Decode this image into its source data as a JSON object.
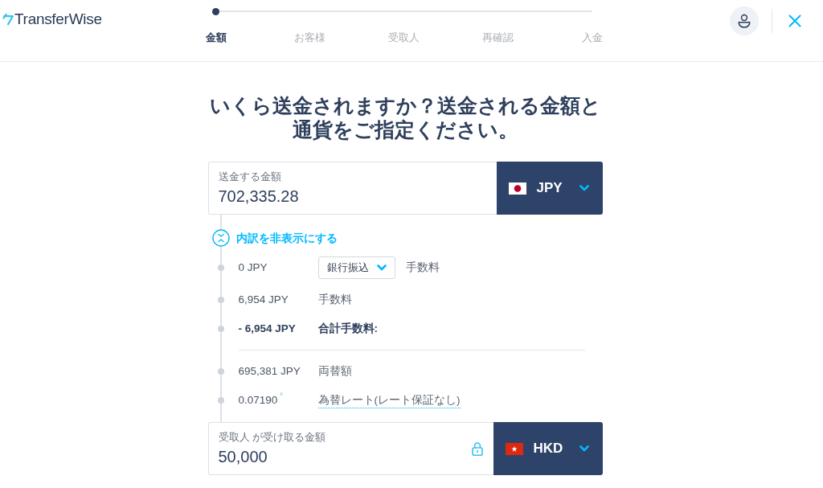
{
  "header": {
    "logo": "TransferWise",
    "steps": [
      {
        "label": "金額",
        "selected": true
      },
      {
        "label": "お客様",
        "selected": false
      },
      {
        "label": "受取人",
        "selected": false
      },
      {
        "label": "再確認",
        "selected": false
      },
      {
        "label": "入金",
        "selected": false
      }
    ]
  },
  "title": "いくら送金されますか？送金される金額と通貨をご指定ください。",
  "send": {
    "kind": "jp",
    "label": "送金する金額",
    "value": "702,335.28",
    "currency": "JPY"
  },
  "breakdown": {
    "toggle": "内訳を非表示にする",
    "expanded": true,
    "rows": [
      {
        "kind": "select",
        "amount": "0 JPY",
        "method": "銀行振込",
        "label": "手数料"
      },
      {
        "kind": "plain",
        "amount": "6,954 JPY",
        "label": "手数料"
      },
      {
        "kind": "total",
        "amount": "- 6,954 JPY",
        "label": "合計手数料:"
      },
      {
        "kind": "plain",
        "amount": "695,381 JPY",
        "label": "両替額"
      },
      {
        "kind": "rate",
        "amount": "0.07190",
        "label": "為替レート(レート保証なし)"
      }
    ]
  },
  "receive": {
    "kind": "hk",
    "label": "受取人 が受け取る金額",
    "value": "50,000",
    "currency": "HKD",
    "locked": true
  }
}
